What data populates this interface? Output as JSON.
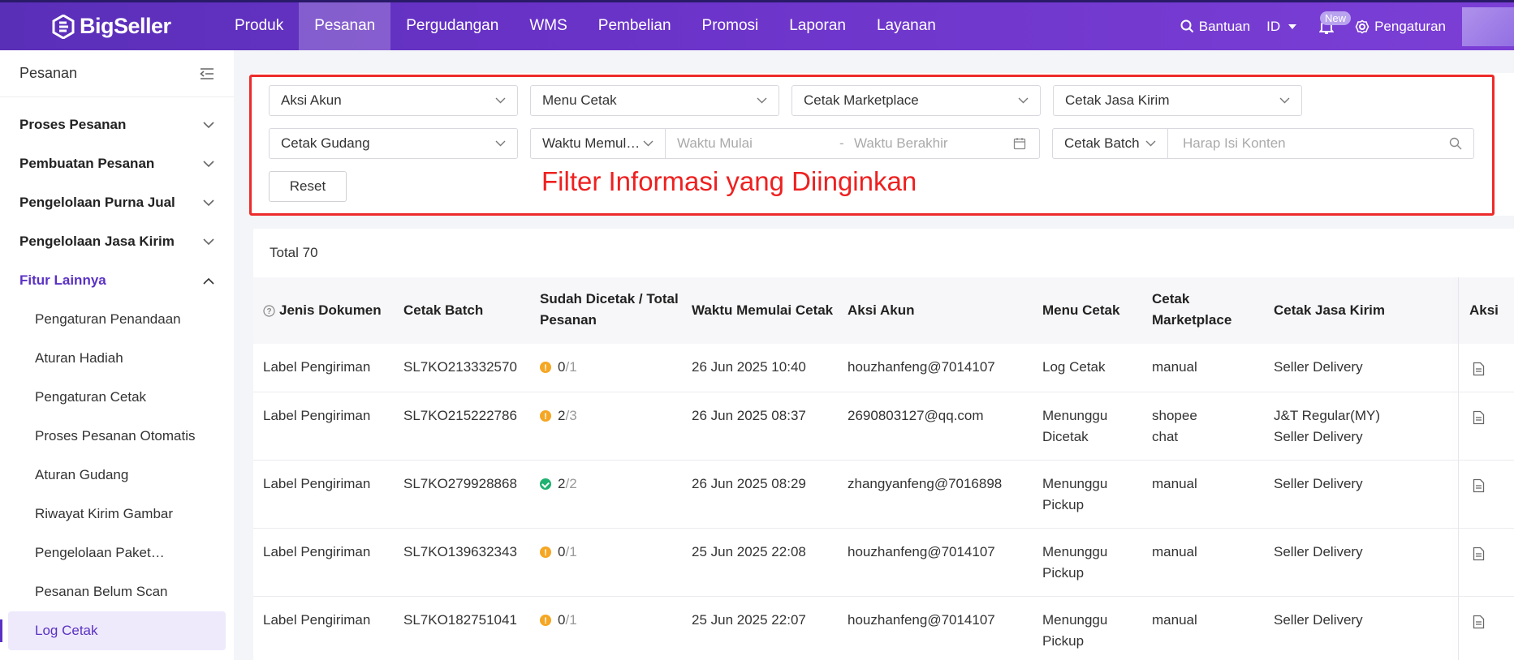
{
  "brand": {
    "name": "BigSeller"
  },
  "nav": {
    "items": [
      "Produk",
      "Pesanan",
      "Pergudangan",
      "WMS",
      "Pembelian",
      "Promosi",
      "Laporan",
      "Layanan"
    ],
    "active": "Pesanan",
    "help": "Bantuan",
    "lang": "ID",
    "new_badge": "New",
    "settings": "Pengaturan"
  },
  "sidebar": {
    "title": "Pesanan",
    "groups": [
      "Proses Pesanan",
      "Pembuatan Pesanan",
      "Pengelolaan Purna Jual",
      "Pengelolaan Jasa Kirim",
      "Fitur Lainnya"
    ],
    "subitems": [
      "Pengaturan Penandaan",
      "Aturan Hadiah",
      "Pengaturan Cetak",
      "Proses Pesanan Otomatis",
      "Aturan Gudang",
      "Riwayat Kirim Gambar",
      "Pengelolaan Paket…",
      "Pesanan Belum Scan",
      "Log Cetak"
    ],
    "active": "Log Cetak"
  },
  "filters": {
    "aksi_akun": "Aksi Akun",
    "menu_cetak": "Menu Cetak",
    "cetak_marketplace": "Cetak Marketplace",
    "cetak_jasa_kirim": "Cetak Jasa Kirim",
    "cetak_gudang": "Cetak Gudang",
    "waktu_type": "Waktu Memul…",
    "start_placeholder": "Waktu Mulai",
    "range_sep": "-",
    "end_placeholder": "Waktu Berakhir",
    "batch_type": "Cetak Batch",
    "search_placeholder": "Harap Isi Konten",
    "reset": "Reset"
  },
  "annotation": "Filter Informasi yang Diinginkan",
  "total_label": "Total 70",
  "table": {
    "headers": [
      "Jenis Dokumen",
      "Cetak Batch",
      "Sudah Dicetak / Total Pesanan",
      "Waktu Memulai Cetak",
      "Aksi Akun",
      "Menu Cetak",
      "Cetak Marketplace",
      "Cetak Jasa Kirim",
      "Aksi"
    ],
    "header_lines": {
      "printed_1": "Sudah Dicetak / Total",
      "printed_2": "Pesanan",
      "market_1": "Cetak",
      "market_2": "Marketplace"
    },
    "rows": [
      {
        "doc": "Label Pengiriman",
        "batch": "SL7KO213332570",
        "status": "warn",
        "printed": "0",
        "total": "/1",
        "time": "26 Jun 2025 10:40",
        "akun": "houzhanfeng@7014107",
        "menu1": "Log Cetak",
        "menu2": "",
        "market1": "manual",
        "market2": "",
        "kirim1": "Seller Delivery",
        "kirim2": ""
      },
      {
        "doc": "Label Pengiriman",
        "batch": "SL7KO215222786",
        "status": "warn",
        "printed": "2",
        "total": "/3",
        "time": "26 Jun 2025 08:37",
        "akun": "2690803127@qq.com",
        "menu1": "Menunggu",
        "menu2": "Dicetak",
        "market1": "shopee",
        "market2": "chat",
        "kirim1": "J&T Regular(MY)",
        "kirim2": "Seller Delivery"
      },
      {
        "doc": "Label Pengiriman",
        "batch": "SL7KO279928868",
        "status": "ok",
        "printed": "2",
        "total": "/2",
        "time": "26 Jun 2025 08:29",
        "akun": "zhangyanfeng@7016898",
        "menu1": "Menunggu",
        "menu2": "Pickup",
        "market1": "manual",
        "market2": "",
        "kirim1": "Seller Delivery",
        "kirim2": ""
      },
      {
        "doc": "Label Pengiriman",
        "batch": "SL7KO139632343",
        "status": "warn",
        "printed": "0",
        "total": "/1",
        "time": "25 Jun 2025 22:08",
        "akun": "houzhanfeng@7014107",
        "menu1": "Menunggu",
        "menu2": "Pickup",
        "market1": "manual",
        "market2": "",
        "kirim1": "Seller Delivery",
        "kirim2": ""
      },
      {
        "doc": "Label Pengiriman",
        "batch": "SL7KO182751041",
        "status": "warn",
        "printed": "0",
        "total": "/1",
        "time": "25 Jun 2025 22:07",
        "akun": "houzhanfeng@7014107",
        "menu1": "Menunggu",
        "menu2": "Pickup",
        "market1": "manual",
        "market2": "",
        "kirim1": "Seller Delivery",
        "kirim2": ""
      }
    ]
  },
  "colors": {
    "brand": "#6a33c8",
    "accent": "#5a31c4",
    "annotation": "#ee2b2b",
    "warn": "#f5a623",
    "ok": "#1fb170"
  }
}
